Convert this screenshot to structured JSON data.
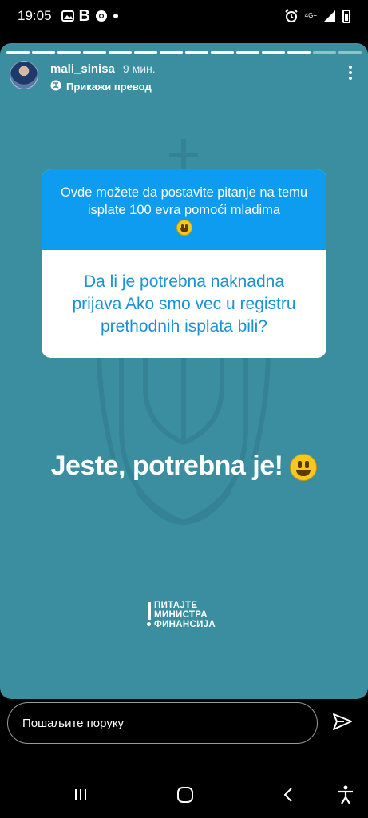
{
  "status_bar": {
    "time": "19:05",
    "left_icons": [
      "gallery-icon",
      "b-app-icon",
      "chrome-icon",
      "notification-dot"
    ],
    "right_icons": [
      "alarm-icon",
      "network-4g-icon",
      "signal-icon",
      "battery-icon"
    ],
    "b_glyph": "B",
    "network_label": "4G+"
  },
  "story": {
    "background_color": "#3a8ea0",
    "progress_segments_total": 14,
    "progress_segments_completed": 12,
    "username": "mali_sinisa",
    "posted_time": "9 мин.",
    "translate_label": "Прикажи превод",
    "question_card": {
      "prompt": "Ovde možete da postavite pitanje na temu isplate 100 evra pomoći mladima",
      "answer": "Da li je potrebna naknadna prijava Ako smo vec u registru prethodnih isplata bili?",
      "header_color": "#0d9cf0",
      "answer_color": "#1a92d6"
    },
    "reply_text": "Jeste, potrebna je!",
    "brand_lines": [
      "ПИТАЈТЕ",
      "МИНИСТРА",
      "ФИНАНСИЈА"
    ]
  },
  "reply_bar": {
    "placeholder": "Пошаљите поруку"
  },
  "nav_bar": {
    "buttons": [
      "recents-icon",
      "home-icon",
      "back-icon",
      "accessibility-icon"
    ]
  }
}
